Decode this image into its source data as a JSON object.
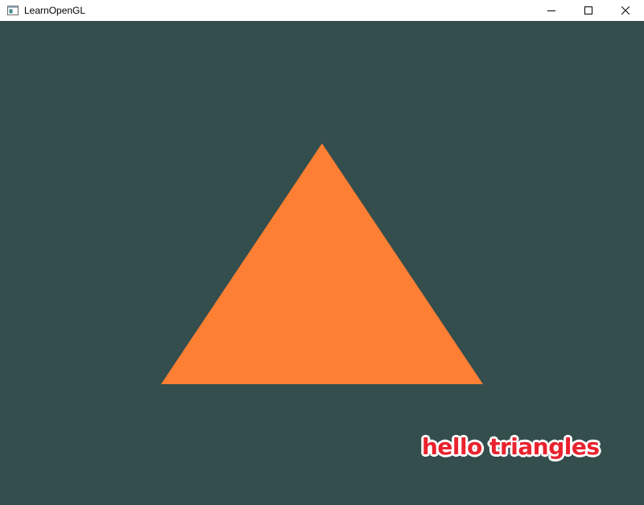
{
  "window": {
    "title": "LearnOpenGL",
    "icon": "opengl-app-icon",
    "controls": {
      "minimize_icon": "minimize-icon",
      "maximize_icon": "maximize-icon",
      "close_icon": "close-icon"
    }
  },
  "viewport": {
    "clear_color": "#344d4d",
    "shape": "triangle",
    "triangle_color": "#fd7f33",
    "overlay_text": "hello triangles",
    "overlay_text_color": "#e8232e"
  }
}
